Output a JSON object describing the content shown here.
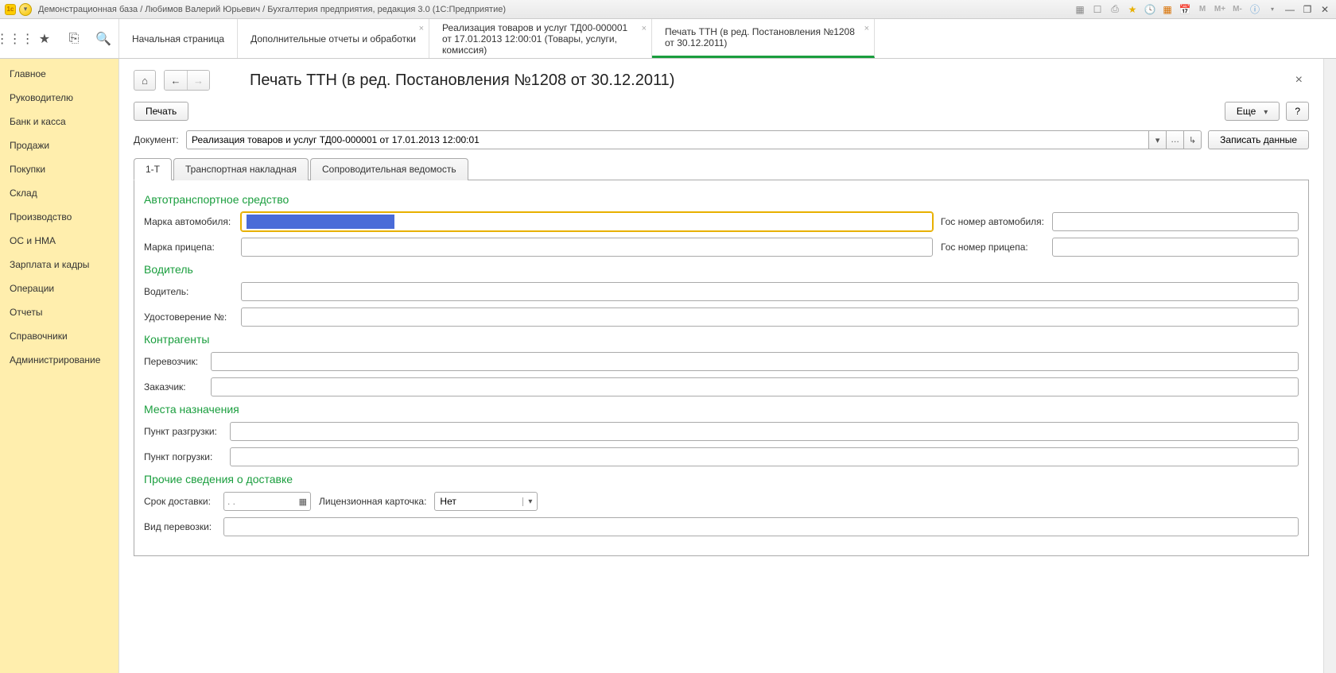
{
  "titlebar": {
    "title": "Демонстрационная база / Любимов Валерий Юрьевич / Бухгалтерия предприятия, редакция 3.0  (1С:Предприятие)",
    "m_labels": [
      "M",
      "M+",
      "M-"
    ]
  },
  "topTabs": [
    {
      "label": "Начальная страница",
      "closable": false
    },
    {
      "label": "Дополнительные отчеты и обработки",
      "closable": true
    },
    {
      "label": "Реализация товаров и услуг ТД00-000001 от 17.01.2013 12:00:01 (Товары, услуги, комиссия)",
      "closable": true
    },
    {
      "label": "Печать ТТН (в ред. Постановления №1208 от 30.12.2011)",
      "closable": true,
      "active": true
    }
  ],
  "sidebar": {
    "items": [
      "Главное",
      "Руководителю",
      "Банк и касса",
      "Продажи",
      "Покупки",
      "Склад",
      "Производство",
      "ОС и НМА",
      "Зарплата и кадры",
      "Операции",
      "Отчеты",
      "Справочники",
      "Администрирование"
    ]
  },
  "page": {
    "title": "Печать ТТН (в ред. Постановления №1208 от 30.12.2011)",
    "print_label": "Печать",
    "more_label": "Еще",
    "help_label": "?",
    "doc_label": "Документ:",
    "doc_value": "Реализация товаров и услуг ТД00-000001 от 17.01.2013 12:00:01",
    "save_data_label": "Записать данные"
  },
  "innerTabs": [
    "1-Т",
    "Транспортная накладная",
    "Сопроводительная ведомость"
  ],
  "sections": {
    "vehicle": {
      "title": "Автотранспортное средство",
      "car_brand_label": "Марка автомобиля:",
      "car_brand_value": "",
      "car_number_label": "Гос номер автомобиля:",
      "car_number_value": "",
      "trailer_brand_label": "Марка прицепа:",
      "trailer_brand_value": "",
      "trailer_number_label": "Гос номер прицепа:",
      "trailer_number_value": ""
    },
    "driver": {
      "title": "Водитель",
      "driver_label": "Водитель:",
      "driver_value": "",
      "license_label": "Удостоверение №:",
      "license_value": ""
    },
    "counterparties": {
      "title": "Контрагенты",
      "carrier_label": "Перевозчик:",
      "carrier_value": "",
      "customer_label": "Заказчик:",
      "customer_value": ""
    },
    "destinations": {
      "title": "Места назначения",
      "unload_label": "Пункт разгрузки:",
      "unload_value": "",
      "load_label": "Пункт погрузки:",
      "load_value": ""
    },
    "other": {
      "title": "Прочие сведения о доставке",
      "delivery_time_label": "Срок доставки:",
      "delivery_time_value": "  .  .    ",
      "license_card_label": "Лицензионная карточка:",
      "license_card_value": "Нет",
      "transport_type_label": "Вид перевозки:",
      "transport_type_value": ""
    }
  }
}
